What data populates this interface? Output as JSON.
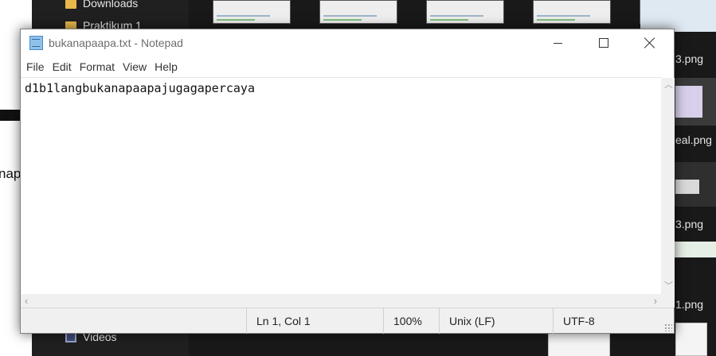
{
  "background": {
    "left_app": {
      "partial_text": "nap"
    },
    "explorer": {
      "nav_items": [
        {
          "label": "Downloads",
          "icon": "folder-icon"
        },
        {
          "label": "Praktikum 1",
          "icon": "folder-icon"
        },
        {
          "label": "Videos",
          "icon": "videos-icon"
        }
      ],
      "file_labels": [
        "3.png",
        "eal.png",
        "3.png",
        "1.png"
      ]
    }
  },
  "notepad": {
    "title": "bukanapaapa.txt - Notepad",
    "menu": [
      "File",
      "Edit",
      "Format",
      "View",
      "Help"
    ],
    "content": "d1b1langbukanapaapajugagapercaya",
    "status": {
      "position": "Ln 1, Col 1",
      "zoom": "100%",
      "line_ending": "Unix (LF)",
      "encoding": "UTF-8"
    }
  }
}
